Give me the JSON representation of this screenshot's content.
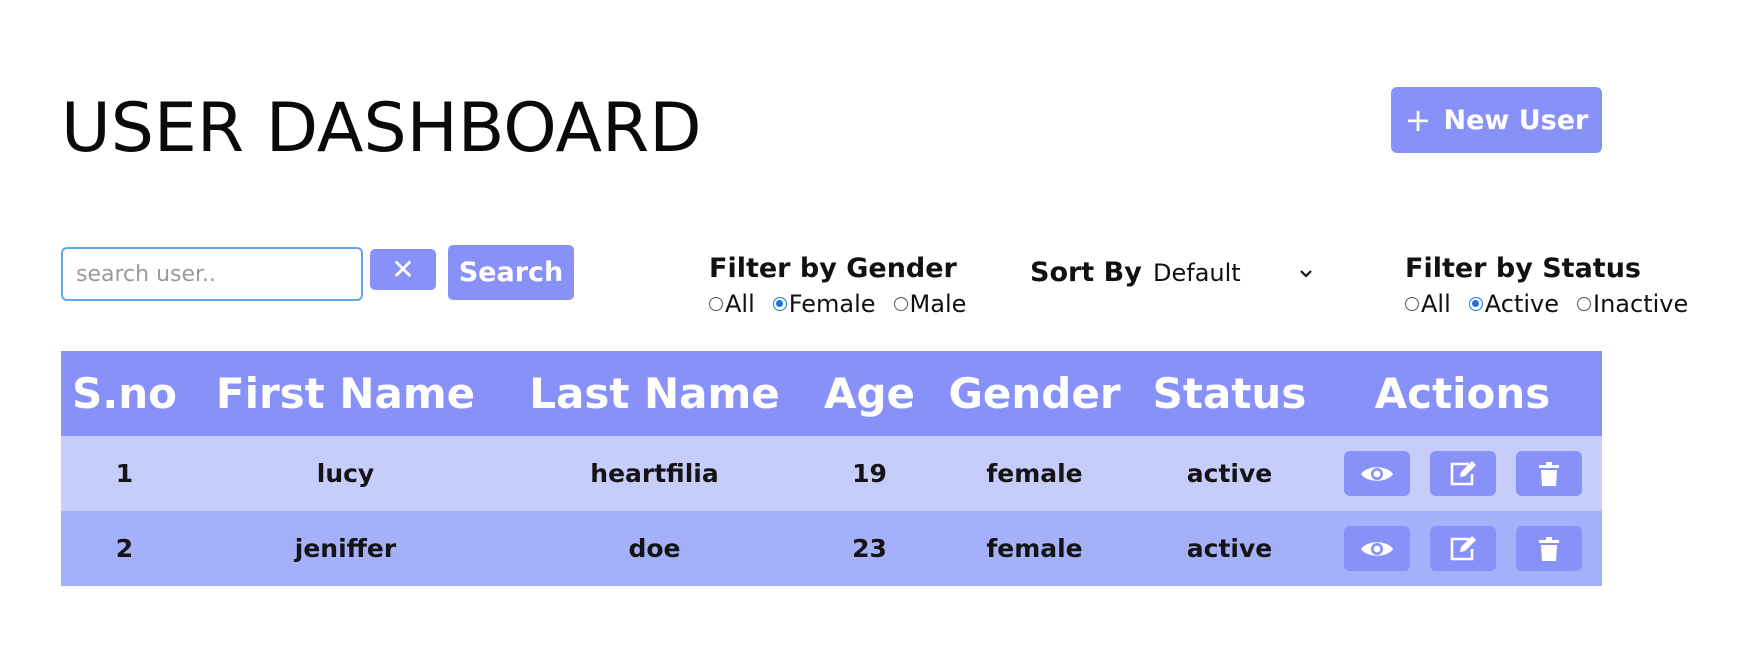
{
  "header": {
    "title": "USER DASHBOARD",
    "new_user_label": "New User",
    "new_user_icon": "plus-icon"
  },
  "search": {
    "placeholder": "search user..",
    "value": "",
    "clear_label": "✕",
    "search_label": "Search"
  },
  "gender_filter": {
    "label": "Filter by Gender",
    "options": [
      "All",
      "Female",
      "Male"
    ],
    "selected": "Female"
  },
  "sort": {
    "label": "Sort By",
    "value": "Default"
  },
  "status_filter": {
    "label": "Filter by Status",
    "options": [
      "All",
      "Active",
      "Inactive"
    ],
    "selected": "Active"
  },
  "table": {
    "headers": [
      "S.no",
      "First Name",
      "Last Name",
      "Age",
      "Gender",
      "Status",
      "Actions"
    ],
    "rows": [
      [
        "1",
        "lucy",
        "heartfilia",
        "19",
        "female",
        "active"
      ],
      [
        "2",
        "jeniffer",
        "doe",
        "23",
        "female",
        "active"
      ]
    ],
    "action_icons": [
      "eye-icon",
      "edit-icon",
      "trash-icon"
    ]
  },
  "colors": {
    "accent": "#8891f7",
    "row_odd": "#c6cdfb",
    "row_even": "#a4b0fa",
    "radio_checked": "#1a73e8",
    "input_border": "#64a4ec"
  }
}
